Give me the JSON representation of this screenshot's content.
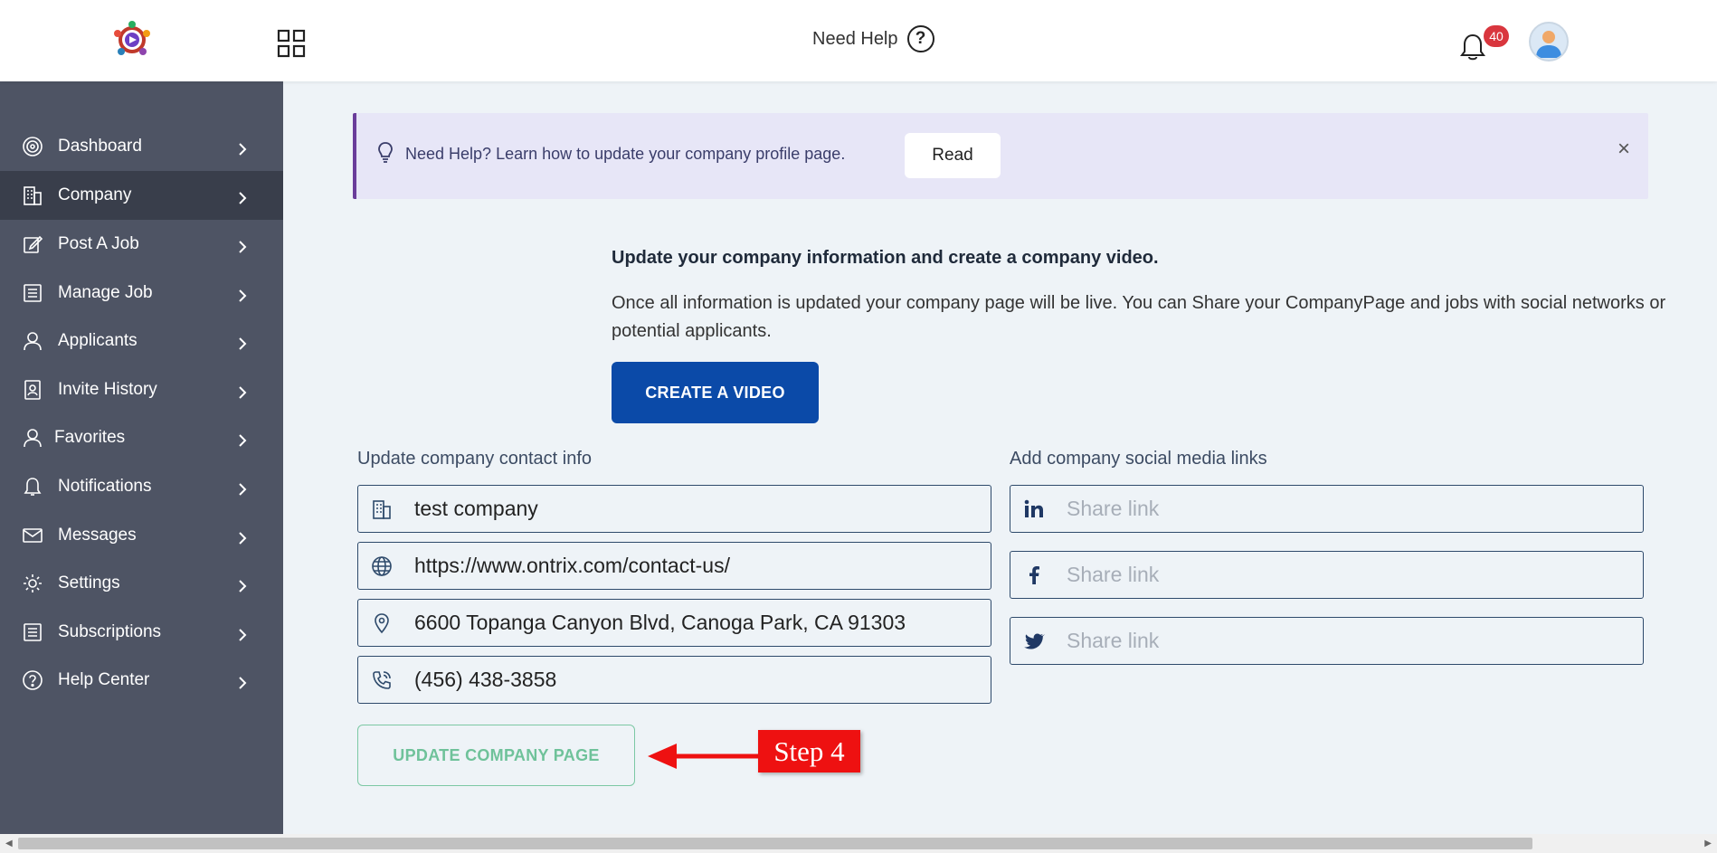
{
  "header": {
    "need_help_label": "Need Help",
    "help_glyph": "?",
    "notification_count": "40",
    "icons": [
      "app-logo",
      "apps-grid-icon",
      "help-circle-icon",
      "bell-icon",
      "user-avatar"
    ]
  },
  "sidebar": {
    "items": [
      {
        "label": "Dashboard",
        "icon": "target-icon",
        "active": false
      },
      {
        "label": "Company",
        "icon": "building-icon",
        "active": true
      },
      {
        "label": "Post A Job",
        "icon": "edit-icon",
        "active": false
      },
      {
        "label": "Manage Job",
        "icon": "list-icon",
        "active": false
      },
      {
        "label": "Applicants",
        "icon": "person-icon",
        "active": false
      },
      {
        "label": "Invite History",
        "icon": "invite-icon",
        "active": false
      },
      {
        "label": "Favorites",
        "icon": "person-icon",
        "active": false
      },
      {
        "label": "Notifications",
        "icon": "bell-icon",
        "active": false
      },
      {
        "label": "Messages",
        "icon": "mail-icon",
        "active": false
      },
      {
        "label": "Settings",
        "icon": "gear-icon",
        "active": false
      },
      {
        "label": "Subscriptions",
        "icon": "list-icon",
        "active": false
      },
      {
        "label": "Help Center",
        "icon": "help-icon",
        "active": false
      }
    ]
  },
  "banner": {
    "text": "Need Help? Learn how to update your company profile page.",
    "read_label": "Read",
    "close_glyph": "×"
  },
  "intro": {
    "title": "Update your company information and create a company video.",
    "desc_line1": "Once all information is updated your company page will be live. You can Share your CompanyPage and jobs with social networks or",
    "desc_line2": "potential applicants.",
    "create_video_label": "CREATE A VIDEO"
  },
  "contact": {
    "label": "Update company contact info",
    "company_name": "test company",
    "website": "https://www.ontrix.com/contact-us/",
    "address": "6600 Topanga Canyon Blvd, Canoga Park, CA 91303",
    "phone": "(456) 438-3858"
  },
  "social": {
    "label": "Add company social media links",
    "linkedin_placeholder": "Share link",
    "facebook_placeholder": "Share link",
    "twitter_placeholder": "Share link"
  },
  "actions": {
    "update_label": "UPDATE COMPANY PAGE"
  },
  "annotation": {
    "step_label": "Step 4",
    "color": "#ee1111"
  },
  "colors": {
    "sidebar_bg": "#4e5464",
    "sidebar_active": "#393e4b",
    "primary_button": "#0b4aa8",
    "update_button_text": "#6fc29a",
    "badge": "#d9363e"
  }
}
